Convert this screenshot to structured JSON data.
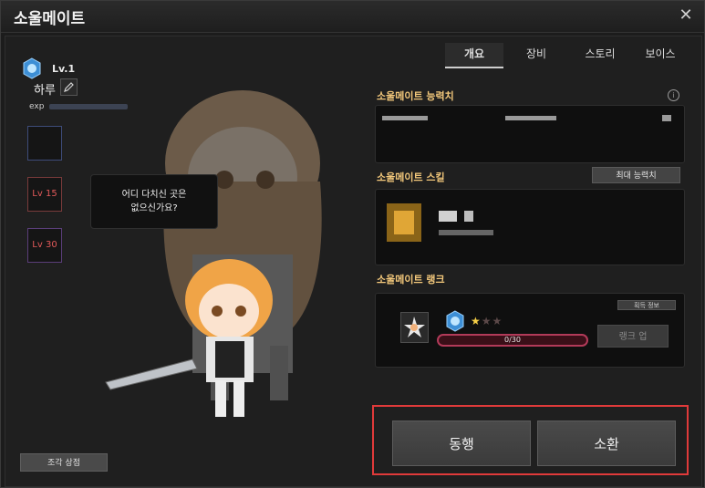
{
  "window": {
    "title": "소울메이트"
  },
  "profile": {
    "level": "Lv.1",
    "name": "하루",
    "exp_label": "exp"
  },
  "slots": [
    {
      "label": ""
    },
    {
      "label": "Lv 15"
    },
    {
      "label": "Lv 30"
    }
  ],
  "speech": {
    "line1": "어디 다치신 곳은",
    "line2": "없으신가요?"
  },
  "tabs": [
    {
      "label": "개요"
    },
    {
      "label": "장비"
    },
    {
      "label": "스토리"
    },
    {
      "label": "보이스"
    }
  ],
  "sections": {
    "ability": {
      "title": "소울메이트 능력치"
    },
    "skill": {
      "title": "소울메이트 스킬",
      "max_button": "최대 능력치"
    },
    "rank": {
      "title": "소울메이트 랭크",
      "info_button": "획득 정보",
      "progress_text": "0/30",
      "progress": 0,
      "stars_filled": 1,
      "stars_total": 3,
      "rankup_button": "랭크 업"
    }
  },
  "buttons": {
    "shop": "조각 상점",
    "accompany": "동행",
    "summon": "소환"
  },
  "colors": {
    "accent_gold": "#f3c87b",
    "progress_border": "#b23a59",
    "highlight_red": "#e03a3a"
  }
}
